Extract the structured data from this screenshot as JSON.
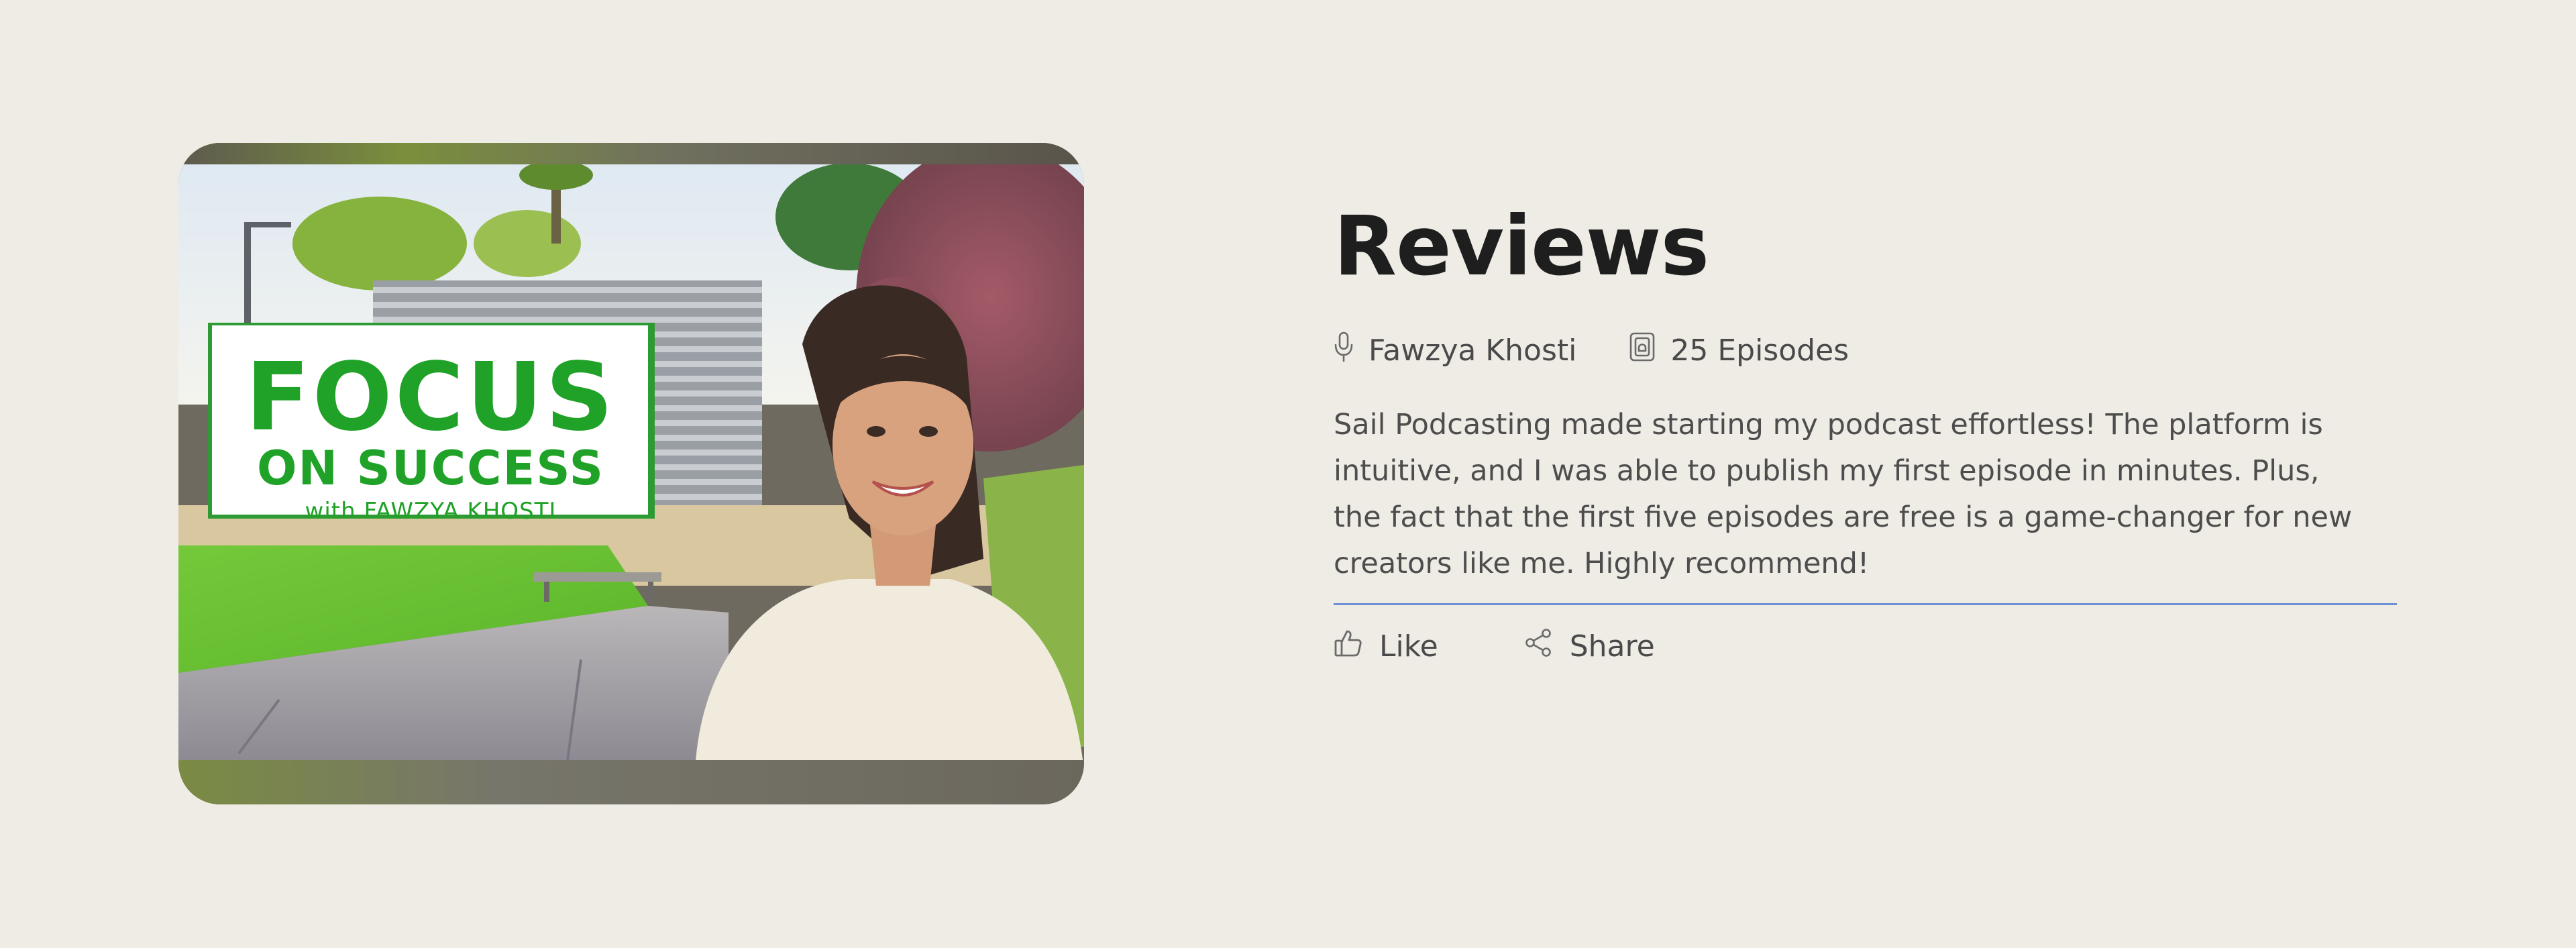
{
  "cover": {
    "sign_line1": "FOCUS",
    "sign_line2": "ON SUCCESS",
    "sign_line3": "with FAWZYA KHOSTI"
  },
  "review": {
    "title": "Reviews",
    "author": "Fawzya Khosti",
    "episodes": "25 Episodes",
    "body": "Sail Podcasting made starting my podcast effortless! The platform is intuitive, and I was able to publish my first episode in minutes. Plus, the fact that the first five episodes are free is a game-changer for new creators like me. Highly recommend!"
  },
  "actions": {
    "like_label": "Like",
    "share_label": "Share"
  },
  "icons": {
    "author": "microphone-icon",
    "episodes": "episodes-icon",
    "like": "thumbs-up-icon",
    "share": "share-icon"
  },
  "colors": {
    "background": "#efece6",
    "divider": "#6e8fd4",
    "sign_green": "#1fa227"
  }
}
